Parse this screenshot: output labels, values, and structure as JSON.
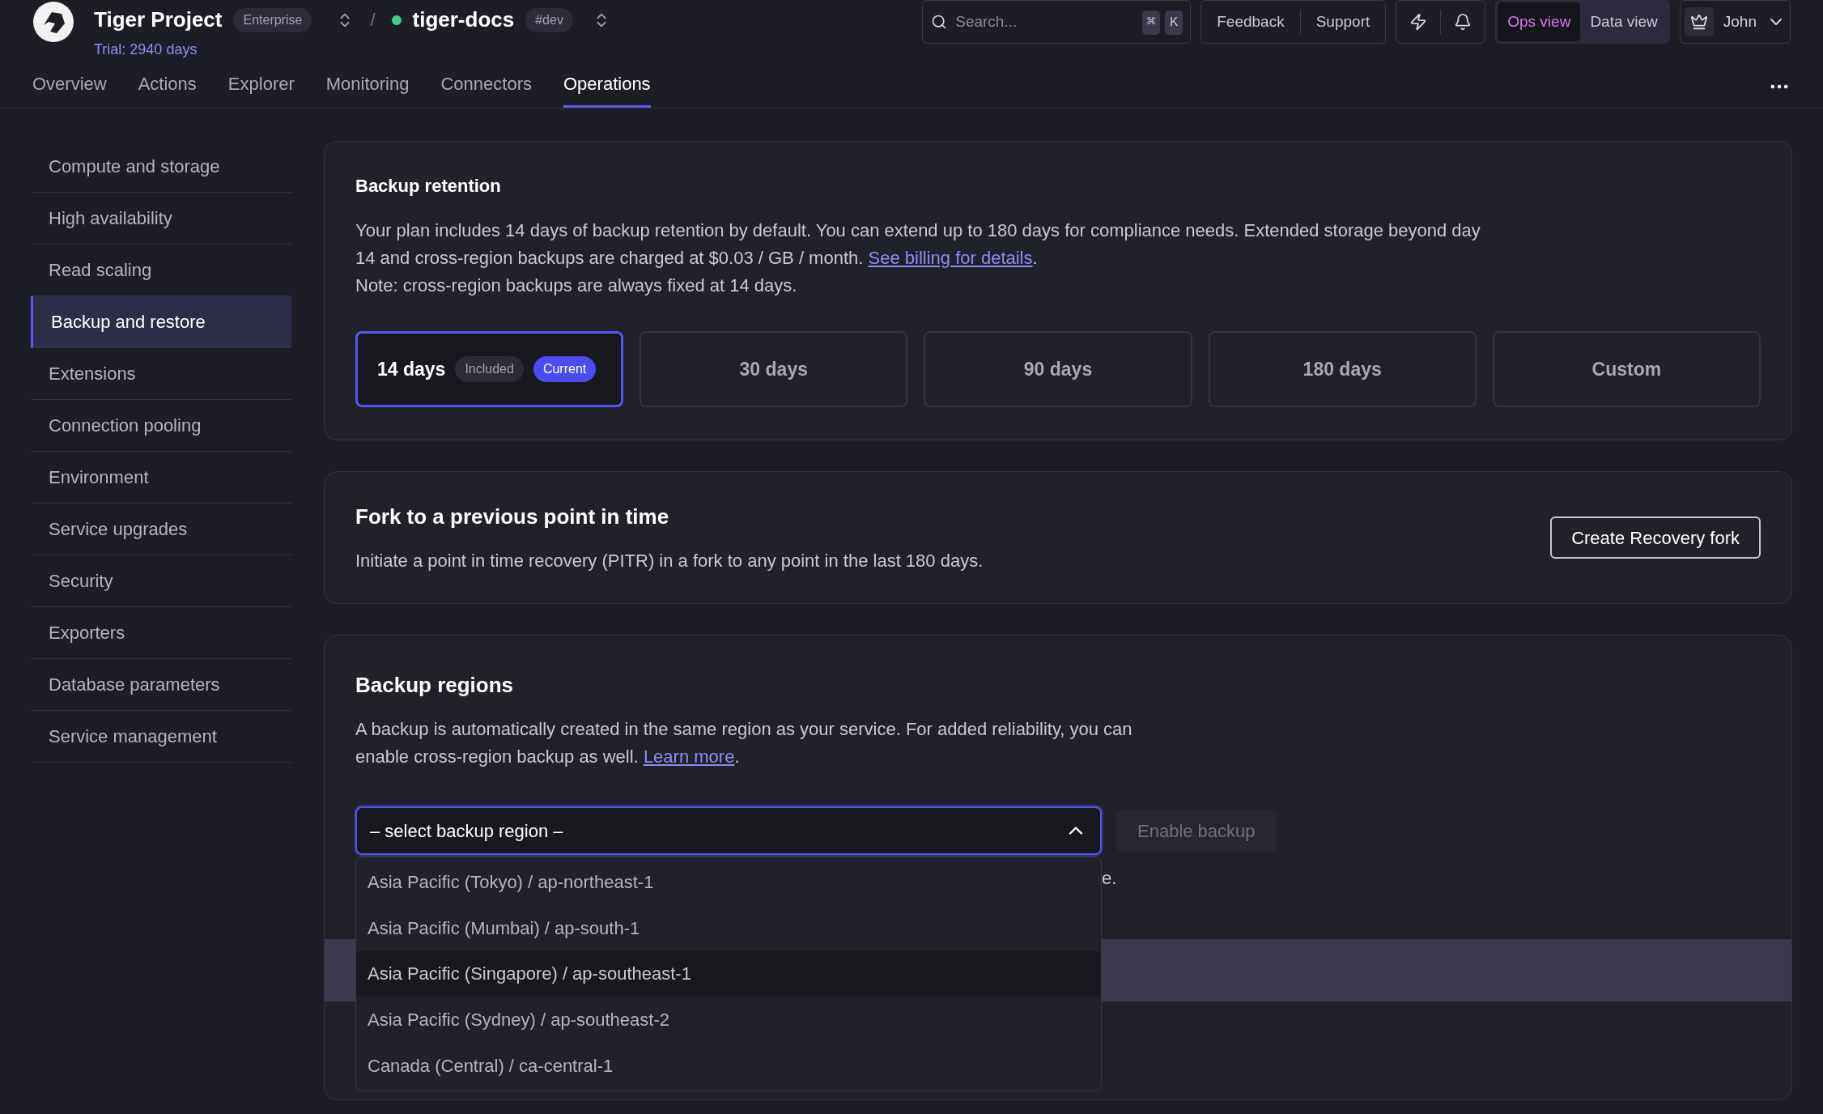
{
  "header": {
    "project": "Tiger Project",
    "plan_badge": "Enterprise",
    "trial": "Trial: 2940 days",
    "separator": "/",
    "service": {
      "name": "tiger-docs",
      "color": "#3ecf8e"
    },
    "env_badge": "#dev",
    "search": {
      "placeholder": "Search...",
      "keys": [
        "⌘",
        "K"
      ]
    },
    "links": [
      "Feedback",
      "Support"
    ],
    "views": [
      {
        "label": "Ops view",
        "selected": true
      },
      {
        "label": "Data view",
        "selected": false
      }
    ],
    "user": "John"
  },
  "tabs": [
    {
      "label": "Overview",
      "selected": false
    },
    {
      "label": "Actions",
      "selected": false
    },
    {
      "label": "Explorer",
      "selected": false
    },
    {
      "label": "Monitoring",
      "selected": false
    },
    {
      "label": "Connectors",
      "selected": false
    },
    {
      "label": "Operations",
      "selected": true
    }
  ],
  "sidebar": {
    "items": [
      {
        "label": "Compute and storage",
        "selected": false
      },
      {
        "label": "High availability",
        "selected": false
      },
      {
        "label": "Read scaling",
        "selected": false
      },
      {
        "label": "Backup and restore",
        "selected": true
      },
      {
        "label": "Extensions",
        "selected": false
      },
      {
        "label": "Connection pooling",
        "selected": false
      },
      {
        "label": "Environment",
        "selected": false
      },
      {
        "label": "Service upgrades",
        "selected": false
      },
      {
        "label": "Security",
        "selected": false
      },
      {
        "label": "Exporters",
        "selected": false
      },
      {
        "label": "Database parameters",
        "selected": false
      },
      {
        "label": "Service management",
        "selected": false
      }
    ]
  },
  "retention": {
    "title": "Backup retention",
    "description": "Your plan includes 14 days of backup retention by default. You can extend up to 180 days for compliance needs. Extended storage beyond day 14 and cross-region backups are charged at $0.03 / GB / month.",
    "link": "See billing for details",
    "link_end": ".",
    "note": "Note: cross-region backups are always fixed at 14 days.",
    "options": [
      {
        "label": "14 days",
        "badges": [
          "Included",
          "Current"
        ],
        "selected": true
      },
      {
        "label": "30 days",
        "selected": false
      },
      {
        "label": "90 days",
        "selected": false
      },
      {
        "label": "180 days",
        "selected": false
      },
      {
        "label": "Custom",
        "selected": false
      }
    ]
  },
  "fork": {
    "title": "Fork to a previous point in time",
    "description": "Initiate a point in time recovery (PITR) in a fork to any point in the last 180 days.",
    "button": "Create Recovery fork"
  },
  "regions": {
    "title": "Backup regions",
    "description": "A backup is automatically created in the same region as your service. For added reliability, you can enable cross-region backup as well.",
    "link": "Learn more",
    "link_end": ".",
    "select": {
      "value": "– select backup region –",
      "expanded": true
    },
    "enable_button": {
      "label": "Enable backup",
      "disabled": true
    },
    "hidden_note": "e.",
    "options": [
      {
        "label": "Asia Pacific (Tokyo) / ap-northeast-1",
        "selected": false
      },
      {
        "label": "Asia Pacific (Mumbai) / ap-south-1",
        "selected": false
      },
      {
        "label": "Asia Pacific (Singapore) / ap-southeast-1",
        "selected": true
      },
      {
        "label": "Asia Pacific (Sydney) / ap-southeast-2",
        "selected": false
      },
      {
        "label": "Canada (Central) / ca-central-1",
        "selected": false
      }
    ]
  }
}
